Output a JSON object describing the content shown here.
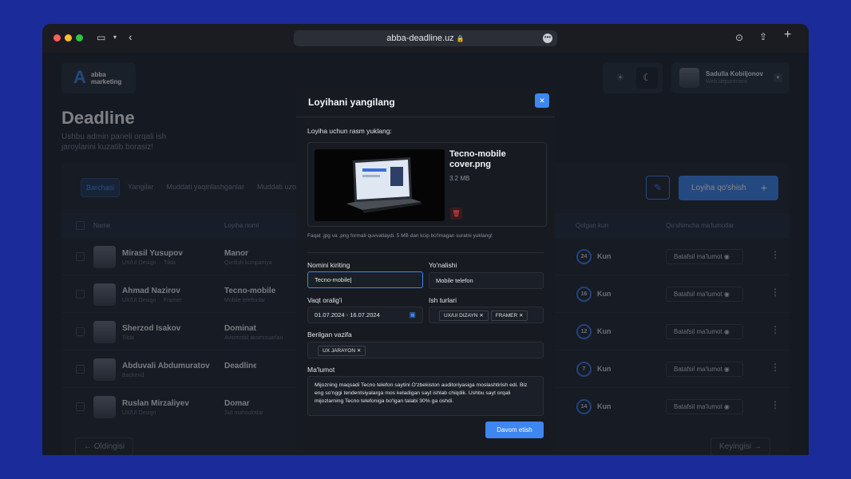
{
  "browser": {
    "url": "abba-deadline.uz"
  },
  "logo": {
    "line1": "abba",
    "line2": "marketing"
  },
  "header": {
    "title": "Deadline",
    "subtitle": "Ushbu admin paneli orqali ish jaroylarini kuzatib borasiz!"
  },
  "user": {
    "name": "Sadulla Kobiljonov",
    "role": "Web department"
  },
  "tabs": [
    "Barchasi",
    "Yangilar",
    "Muddati yaqinlashganlar",
    "Muddati uzoq"
  ],
  "table": {
    "headers": {
      "name": "Name",
      "project": "Loyiha nomi",
      "days": "Qolgan kun",
      "extra": "Qo'shimcha ma'lumotlar"
    },
    "rows": [
      {
        "name": "Mirasil Yusupov",
        "role": "UX/UI Design",
        "tag": "Tilda",
        "project": "Manor",
        "desc": "Qurilish kompaniya",
        "days": "24",
        "unit": "Kun",
        "button": "Batafsil ma'lumot"
      },
      {
        "name": "Ahmad Nazirov",
        "role": "UX/UI Design",
        "tag": "Framer",
        "project": "Tecno-mobile",
        "desc": "Mobile telefonlar",
        "days": "16",
        "unit": "Kun",
        "button": "Batafsil ma'lumot"
      },
      {
        "name": "Sherzod Isakov",
        "role": "Tilda",
        "tag": "",
        "project": "Dominat",
        "desc": "Aviomobil aksessuarlari",
        "days": "12",
        "unit": "Kun",
        "button": "Batafsil ma'lumot"
      },
      {
        "name": "Abduvali Abdumuratov",
        "role": "Backend",
        "tag": "",
        "project": "Deadline",
        "desc": "",
        "days": "7",
        "unit": "Kun",
        "button": "Batafsil ma'lumot"
      },
      {
        "name": "Ruslan Mirzaliyev",
        "role": "UX/UI Design",
        "tag": "",
        "project": "Domar",
        "desc": "Sut mahsulotlar",
        "days": "14",
        "unit": "Kun",
        "button": "Batafsil ma'lumot"
      }
    ]
  },
  "actions": {
    "add": "Loyiha qo'shish"
  },
  "pagination": {
    "prev": "Oldingisi",
    "next": "Keyingisi"
  },
  "modal": {
    "title": "Loyihani yangilang",
    "upload_label": "Loyiha uchun rasm yuklang:",
    "file_name": "Tecno-mobile cover.png",
    "file_size": "3.2 MB",
    "hint": "Faqat .jpg  va .png formati quvvatlaydi. 5 MB dan kcip bo'lmagan suratni yuklang!",
    "name_label": "Nomini kiriting",
    "name_value": "Tecno-mobile",
    "direction_label": "Yo'nalishi",
    "direction_value": "Mobile telefon",
    "time_label": "Vaqt oralig'i",
    "time_value": "01.07.2024 - 16.07.2024",
    "work_label": "Ish turlari",
    "work_chips": [
      "UX/UI DIZAYN",
      "FRAMER"
    ],
    "task_label": "Berilgan vazifa",
    "task_chips": [
      "UX JARAYON"
    ],
    "info_label": "Ma'lumot",
    "info_text": "Mijozning maqsadi Tecno telefon saytini O'zbekiston auditoriyasiga moslashtirish edi. Biz eng so'nggi tendentsiyalarga mos keladigan sayt ishlab chiqdik. Ushbu sayt orqali mijozlarning Tecno telefoniga bo'lgan talabi 30% ga oshdi.",
    "submit": "Davom etish"
  }
}
